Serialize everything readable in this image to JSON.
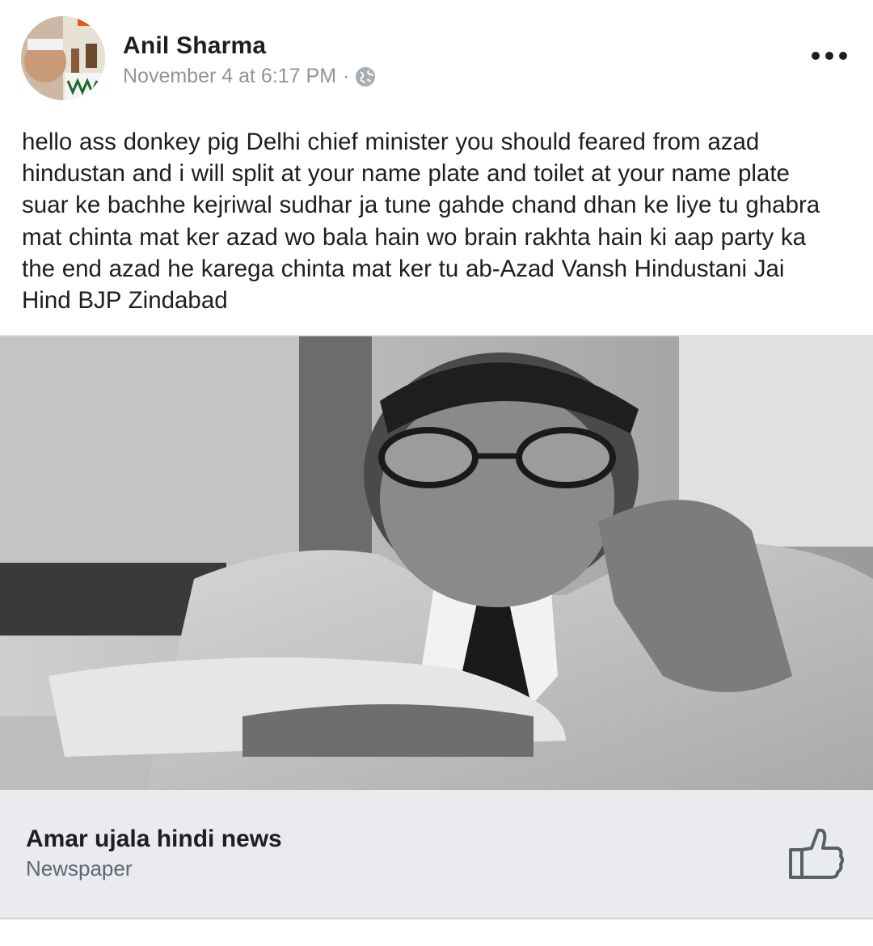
{
  "post": {
    "author": "Anil Sharma",
    "timestamp": "November 4 at 6:17 PM",
    "separator": "·",
    "privacy_icon": "globe-icon",
    "more_icon": "more-options-icon",
    "lines": [
      "hello ass donkey pig Delhi chief minister you should feared from azad",
      "hindustan and i will split at your name plate and toilet at your name plate",
      "suar ke bachhe kejriwal sudhar ja tune gahde chand dhan ke liye tu ghabra",
      "mat chinta mat ker azad wo bala hain wo brain rakhta hain ki aap party ka",
      "the end azad he karega chinta mat ker tu ab-Azad Vansh Hindustani Jai",
      "Hind BJP Zindabad"
    ]
  },
  "link_card": {
    "title": "Amar ujala hindi news",
    "subtitle": "Newspaper",
    "like_icon": "thumbs-up-icon"
  },
  "colors": {
    "text": "#1c1e21",
    "meta": "#90949c",
    "card_bg": "#e9ebee"
  }
}
